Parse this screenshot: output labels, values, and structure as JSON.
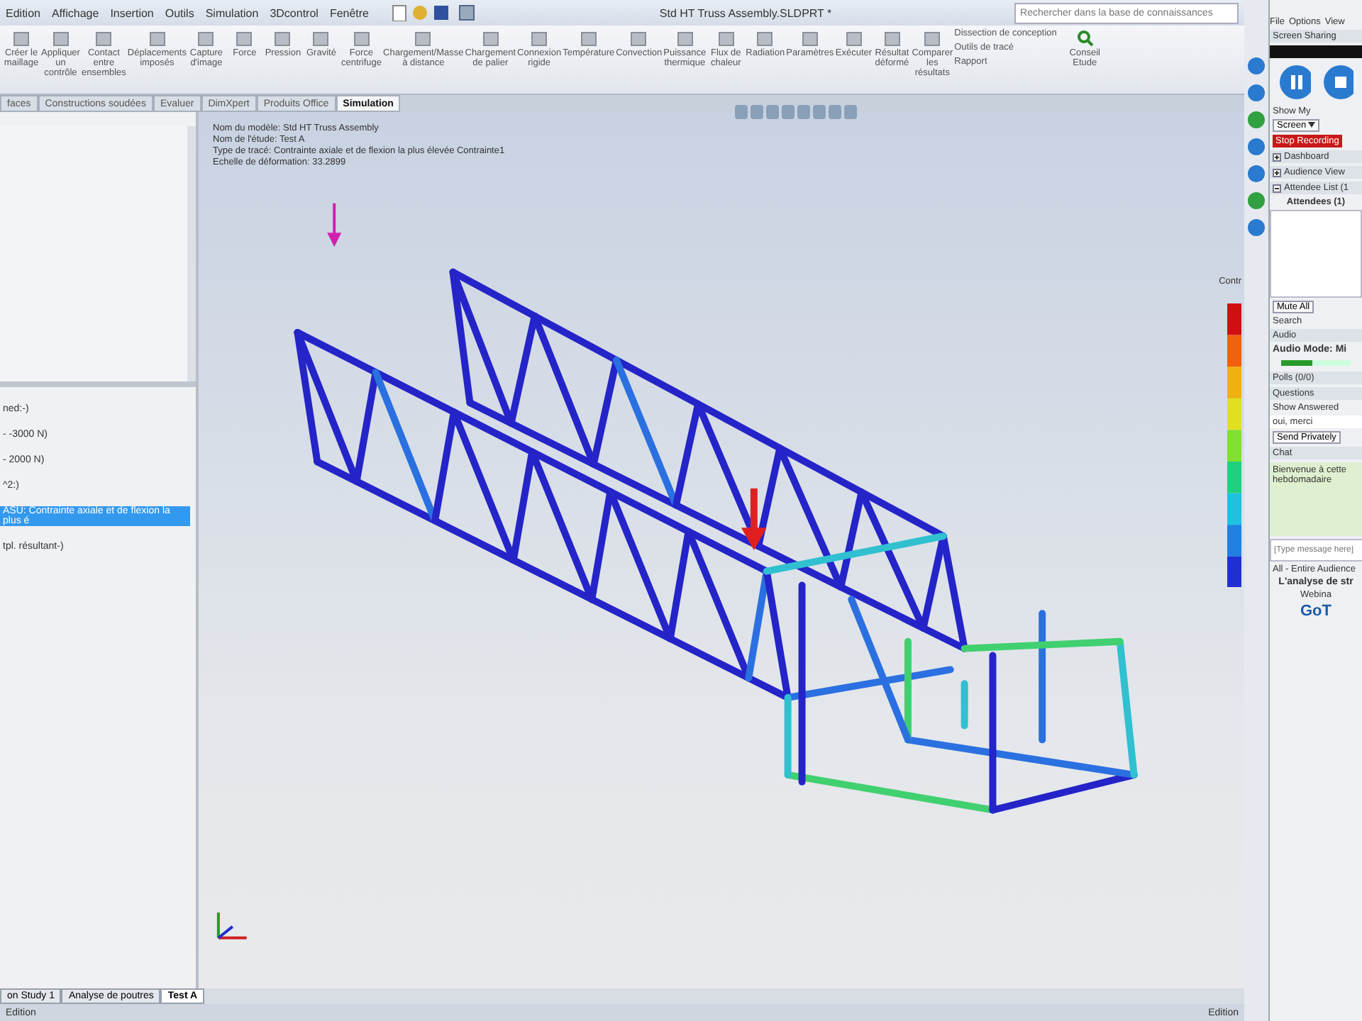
{
  "menu": [
    "Edition",
    "Affichage",
    "Insertion",
    "Outils",
    "Simulation",
    "3Dcontrol",
    "Fenêtre"
  ],
  "title": "Std HT Truss Assembly.SLDPRT *",
  "search": {
    "placeholder": "Rechercher dans la base de connaissances"
  },
  "ribbon": [
    {
      "label": "Créer le maillage"
    },
    {
      "label": "Appliquer un contrôle"
    },
    {
      "label": "Contact entre ensembles"
    },
    {
      "label": "Déplacements imposés"
    },
    {
      "label": "Capture d'image"
    },
    {
      "label": "Force"
    },
    {
      "label": "Pression"
    },
    {
      "label": "Gravité"
    },
    {
      "label": "Force centrifuge"
    },
    {
      "label": "Chargement/Masse à distance"
    },
    {
      "label": "Chargement de palier"
    },
    {
      "label": "Connexion rigide"
    },
    {
      "label": "Température"
    },
    {
      "label": "Convection"
    },
    {
      "label": "Puissance thermique"
    },
    {
      "label": "Flux de chaleur"
    },
    {
      "label": "Radiation"
    },
    {
      "label": "Paramètres"
    },
    {
      "label": "Exécuter"
    },
    {
      "label": "Résultat déformé"
    },
    {
      "label": "Comparer les résultats"
    }
  ],
  "ribbon_list": [
    "Dissection de conception",
    "Outils de tracé",
    "Rapport"
  ],
  "ribbon_end": "Conseil Etude",
  "tabs": [
    {
      "label": "faces",
      "selected": false
    },
    {
      "label": "Constructions soudées",
      "selected": false
    },
    {
      "label": "Evaluer",
      "selected": false
    },
    {
      "label": "DimXpert",
      "selected": false
    },
    {
      "label": "Produits Office",
      "selected": false
    },
    {
      "label": "Simulation",
      "selected": true
    }
  ],
  "tree_lines": [
    {
      "text": "ned:-)",
      "selected": false
    },
    {
      "text": "- -3000 N)",
      "selected": false
    },
    {
      "text": "- 2000 N)",
      "selected": false
    },
    {
      "text": "^2:)",
      "selected": false
    },
    {
      "text": "ASU: Contrainte axiale et de flexion la plus é",
      "selected": true
    },
    {
      "text": "tpl. résultant-)",
      "selected": false
    }
  ],
  "model_info": [
    "Nom du modèle: Std HT Truss Assembly",
    "Nom de l'étude: Test A",
    "Type de tracé: Contrainte axiale et de flexion la plus élevée Contrainte1",
    "Echelle de déformation: 33.2899"
  ],
  "legend": {
    "label": "Contr"
  },
  "study_tabs": [
    {
      "label": "on Study 1",
      "selected": false
    },
    {
      "label": "Analyse de poutres",
      "selected": false
    },
    {
      "label": "Test A",
      "selected": true
    }
  ],
  "status": {
    "left": "Edition",
    "right": "Edition"
  },
  "webinar": {
    "menu": [
      "File",
      "Options",
      "View"
    ],
    "screen_sharing": "Screen Sharing",
    "show_my": "Show My",
    "screen": "Screen",
    "stop": "Stop Recording",
    "sections": [
      {
        "label": "Dashboard",
        "expanded": false
      },
      {
        "label": "Audience View",
        "expanded": false
      },
      {
        "label": "Attendee List (1",
        "expanded": true
      }
    ],
    "attendees": "Attendees (1)",
    "mute_all": "Mute All",
    "search_label": "Search",
    "audio": "Audio",
    "audio_mode": "Audio Mode: Mi",
    "audio_meter": {
      "level": 0.45
    },
    "polls": "Polls (0/0)",
    "questions": "Questions",
    "show_answered": "Show Answered",
    "question": "oui, merci",
    "send_privately": "Send Privately",
    "chat": "Chat",
    "chat_message": "Bienvenue à cette hebdomadaire",
    "chat_placeholder": "[Type message here]",
    "audience": "All - Entire Audience",
    "promo": "L'analyse de str",
    "webinar_word": "Webina",
    "brand": "GoT"
  }
}
